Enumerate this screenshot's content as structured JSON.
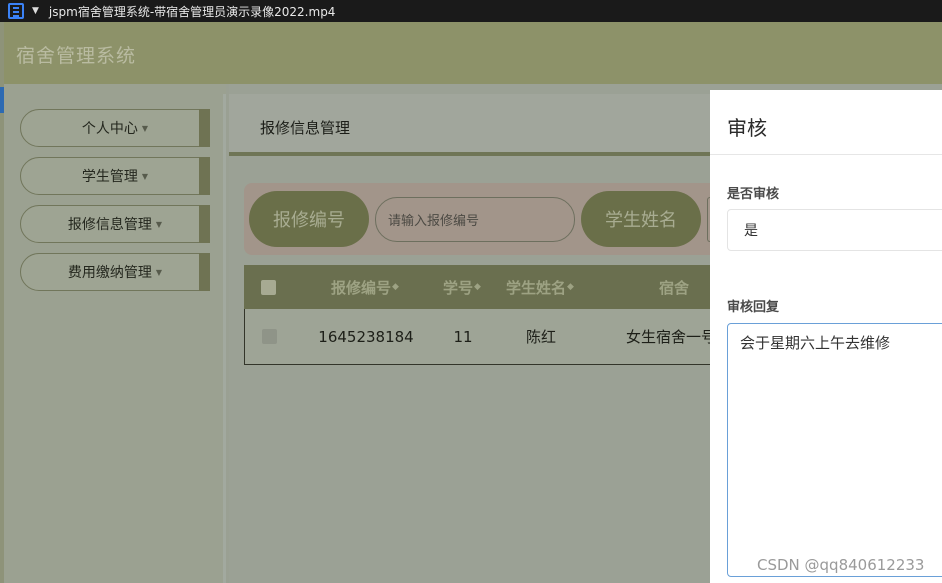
{
  "player": {
    "title": "jspm宿舍管理系统-带宿舍管理员演示录像2022.mp4",
    "icon": "film-strip-icon"
  },
  "header": {
    "brand": "宿舍管理系统"
  },
  "sidebar": {
    "items": [
      {
        "label": "个人中心"
      },
      {
        "label": "学生管理"
      },
      {
        "label": "报修信息管理"
      },
      {
        "label": "费用缴纳管理"
      }
    ]
  },
  "page": {
    "title": "报修信息管理"
  },
  "search": {
    "repair_no_label": "报修编号",
    "repair_no_placeholder": "请输入报修编号",
    "student_name_label": "学生姓名"
  },
  "table": {
    "columns": [
      "报修编号",
      "学号",
      "学生姓名",
      "宿舍"
    ],
    "rows": [
      {
        "repair_no": "1645238184",
        "student_no": "11",
        "student_name": "陈红",
        "dorm": "女生宿舍一号"
      }
    ]
  },
  "drawer": {
    "title": "审核",
    "approve_label": "是否审核",
    "approve_value": "是",
    "reply_label": "审核回复",
    "reply_value": "会于星期六上午去维修"
  },
  "watermark": "CSDN @qq840612233",
  "colors": {
    "header": "#8d9269",
    "accent": "#6a6f49",
    "drawer": "#ffffff"
  }
}
